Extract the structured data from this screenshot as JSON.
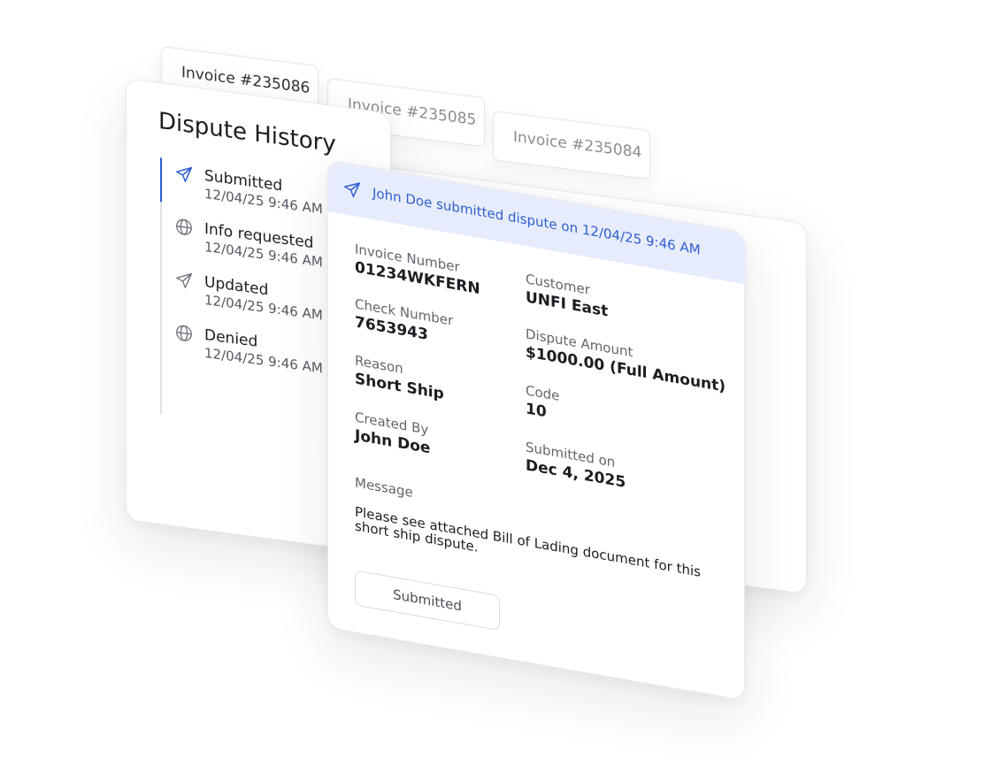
{
  "invoice_tabs": [
    {
      "label": "Invoice #235086",
      "color": "#2d2f35"
    },
    {
      "label": "Invoice #235085",
      "color": "#8a8c93"
    },
    {
      "label": "Invoice #235084",
      "color": "#8a8c93"
    }
  ],
  "history": {
    "title": "Dispute History",
    "items": [
      {
        "title": "Submitted",
        "time": "12/04/25 9:46 AM",
        "icon": "send-icon",
        "active": true
      },
      {
        "title": "Info requested",
        "time": "12/04/25 9:46 AM",
        "icon": "globe-icon",
        "active": false
      },
      {
        "title": "Updated",
        "time": "12/04/25 9:46 AM",
        "icon": "send-icon",
        "active": false
      },
      {
        "title": "Denied",
        "time": "12/04/25 9:46 AM",
        "icon": "globe-icon",
        "active": false
      }
    ]
  },
  "detail": {
    "header_text": "John Doe submitted dispute on 12/04/25 9:46 AM",
    "header_icon": "send-icon",
    "fields_left": [
      {
        "label": "Invoice Number",
        "value": "01234WKFERN"
      },
      {
        "label": "Check Number",
        "value": "7653943"
      },
      {
        "label": "Reason",
        "value": "Short Ship"
      },
      {
        "label": "Created By",
        "value": "John Doe"
      }
    ],
    "fields_right": [
      {
        "label": "Customer",
        "value": "UNFI East"
      },
      {
        "label": "Dispute Amount",
        "value": "$1000.00 (Full Amount)"
      },
      {
        "label": "Code",
        "value": "10"
      },
      {
        "label": "Submitted on",
        "value": "Dec 4, 2025"
      }
    ],
    "message_label": "Message",
    "message": "Please see attached Bill of Lading document for this short ship dispute.",
    "status_button": "Submitted"
  },
  "colors": {
    "accent": "#2f5fd0",
    "header_bg": "#e6ecfb",
    "text_primary": "#1c1d22",
    "text_secondary": "#62646c"
  }
}
